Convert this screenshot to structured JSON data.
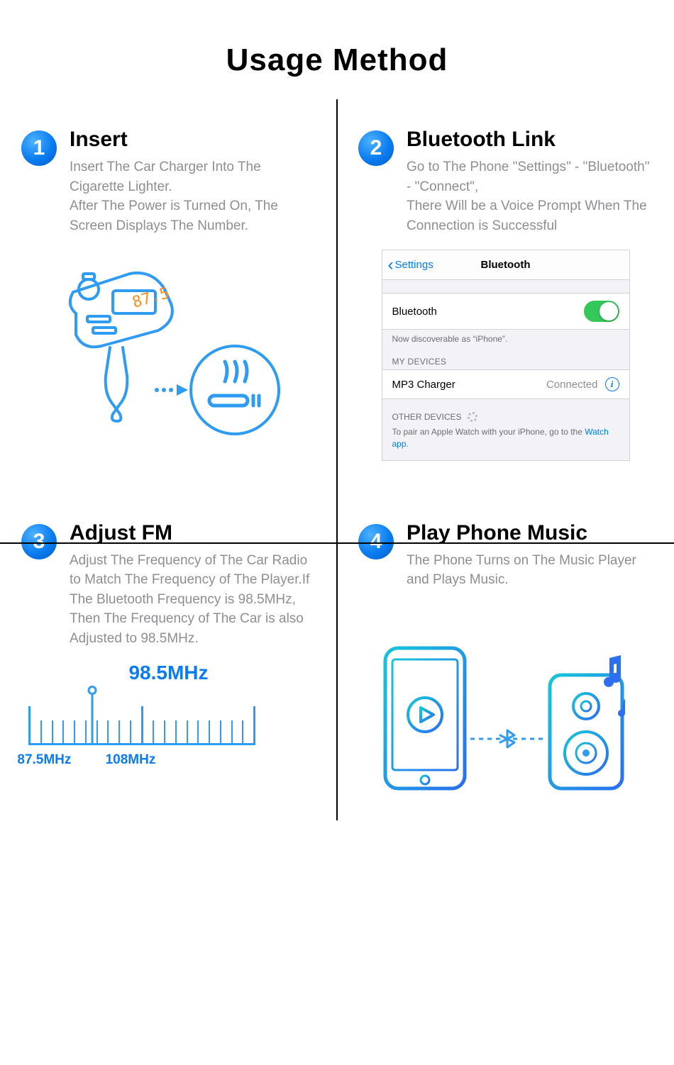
{
  "title": "Usage Method",
  "steps": [
    {
      "num": "1",
      "title": "Insert",
      "desc": "Insert The Car Charger Into The Cigarette Lighter.\nAfter The Power is Turned On, The Screen Displays The Number.",
      "charger_display": "87.5"
    },
    {
      "num": "2",
      "title": "Bluetooth Link",
      "desc": "Go to The Phone \"Settings\" - \"Bluetooth\" - \"Connect\",\nThere Will be a Voice Prompt When The Connection is Successful",
      "ios": {
        "back": "Settings",
        "navTitle": "Bluetooth",
        "toggleRow": "Bluetooth",
        "discoverable": "Now discoverable as “iPhone”.",
        "myDevices": "MY DEVICES",
        "device": "MP3 Charger",
        "connected": "Connected",
        "otherDevices": "OTHER DEVICES",
        "watchHint": "To pair an Apple Watch with your iPhone, go to the ",
        "watchLink": "Watch app."
      }
    },
    {
      "num": "3",
      "title": "Adjust FM",
      "desc": "Adjust The Frequency of The Car Radio to Match The Frequency of The Player.If The Bluetooth Frequency is 98.5MHz, Then The Frequency of The Car is also Adjusted to 98.5MHz.",
      "freq": {
        "current": "98.5MHz",
        "min": "87.5MHz",
        "max": "108MHz"
      }
    },
    {
      "num": "4",
      "title": "Play Phone Music",
      "desc": "The Phone Turns on The Music Player and Plays Music."
    }
  ]
}
